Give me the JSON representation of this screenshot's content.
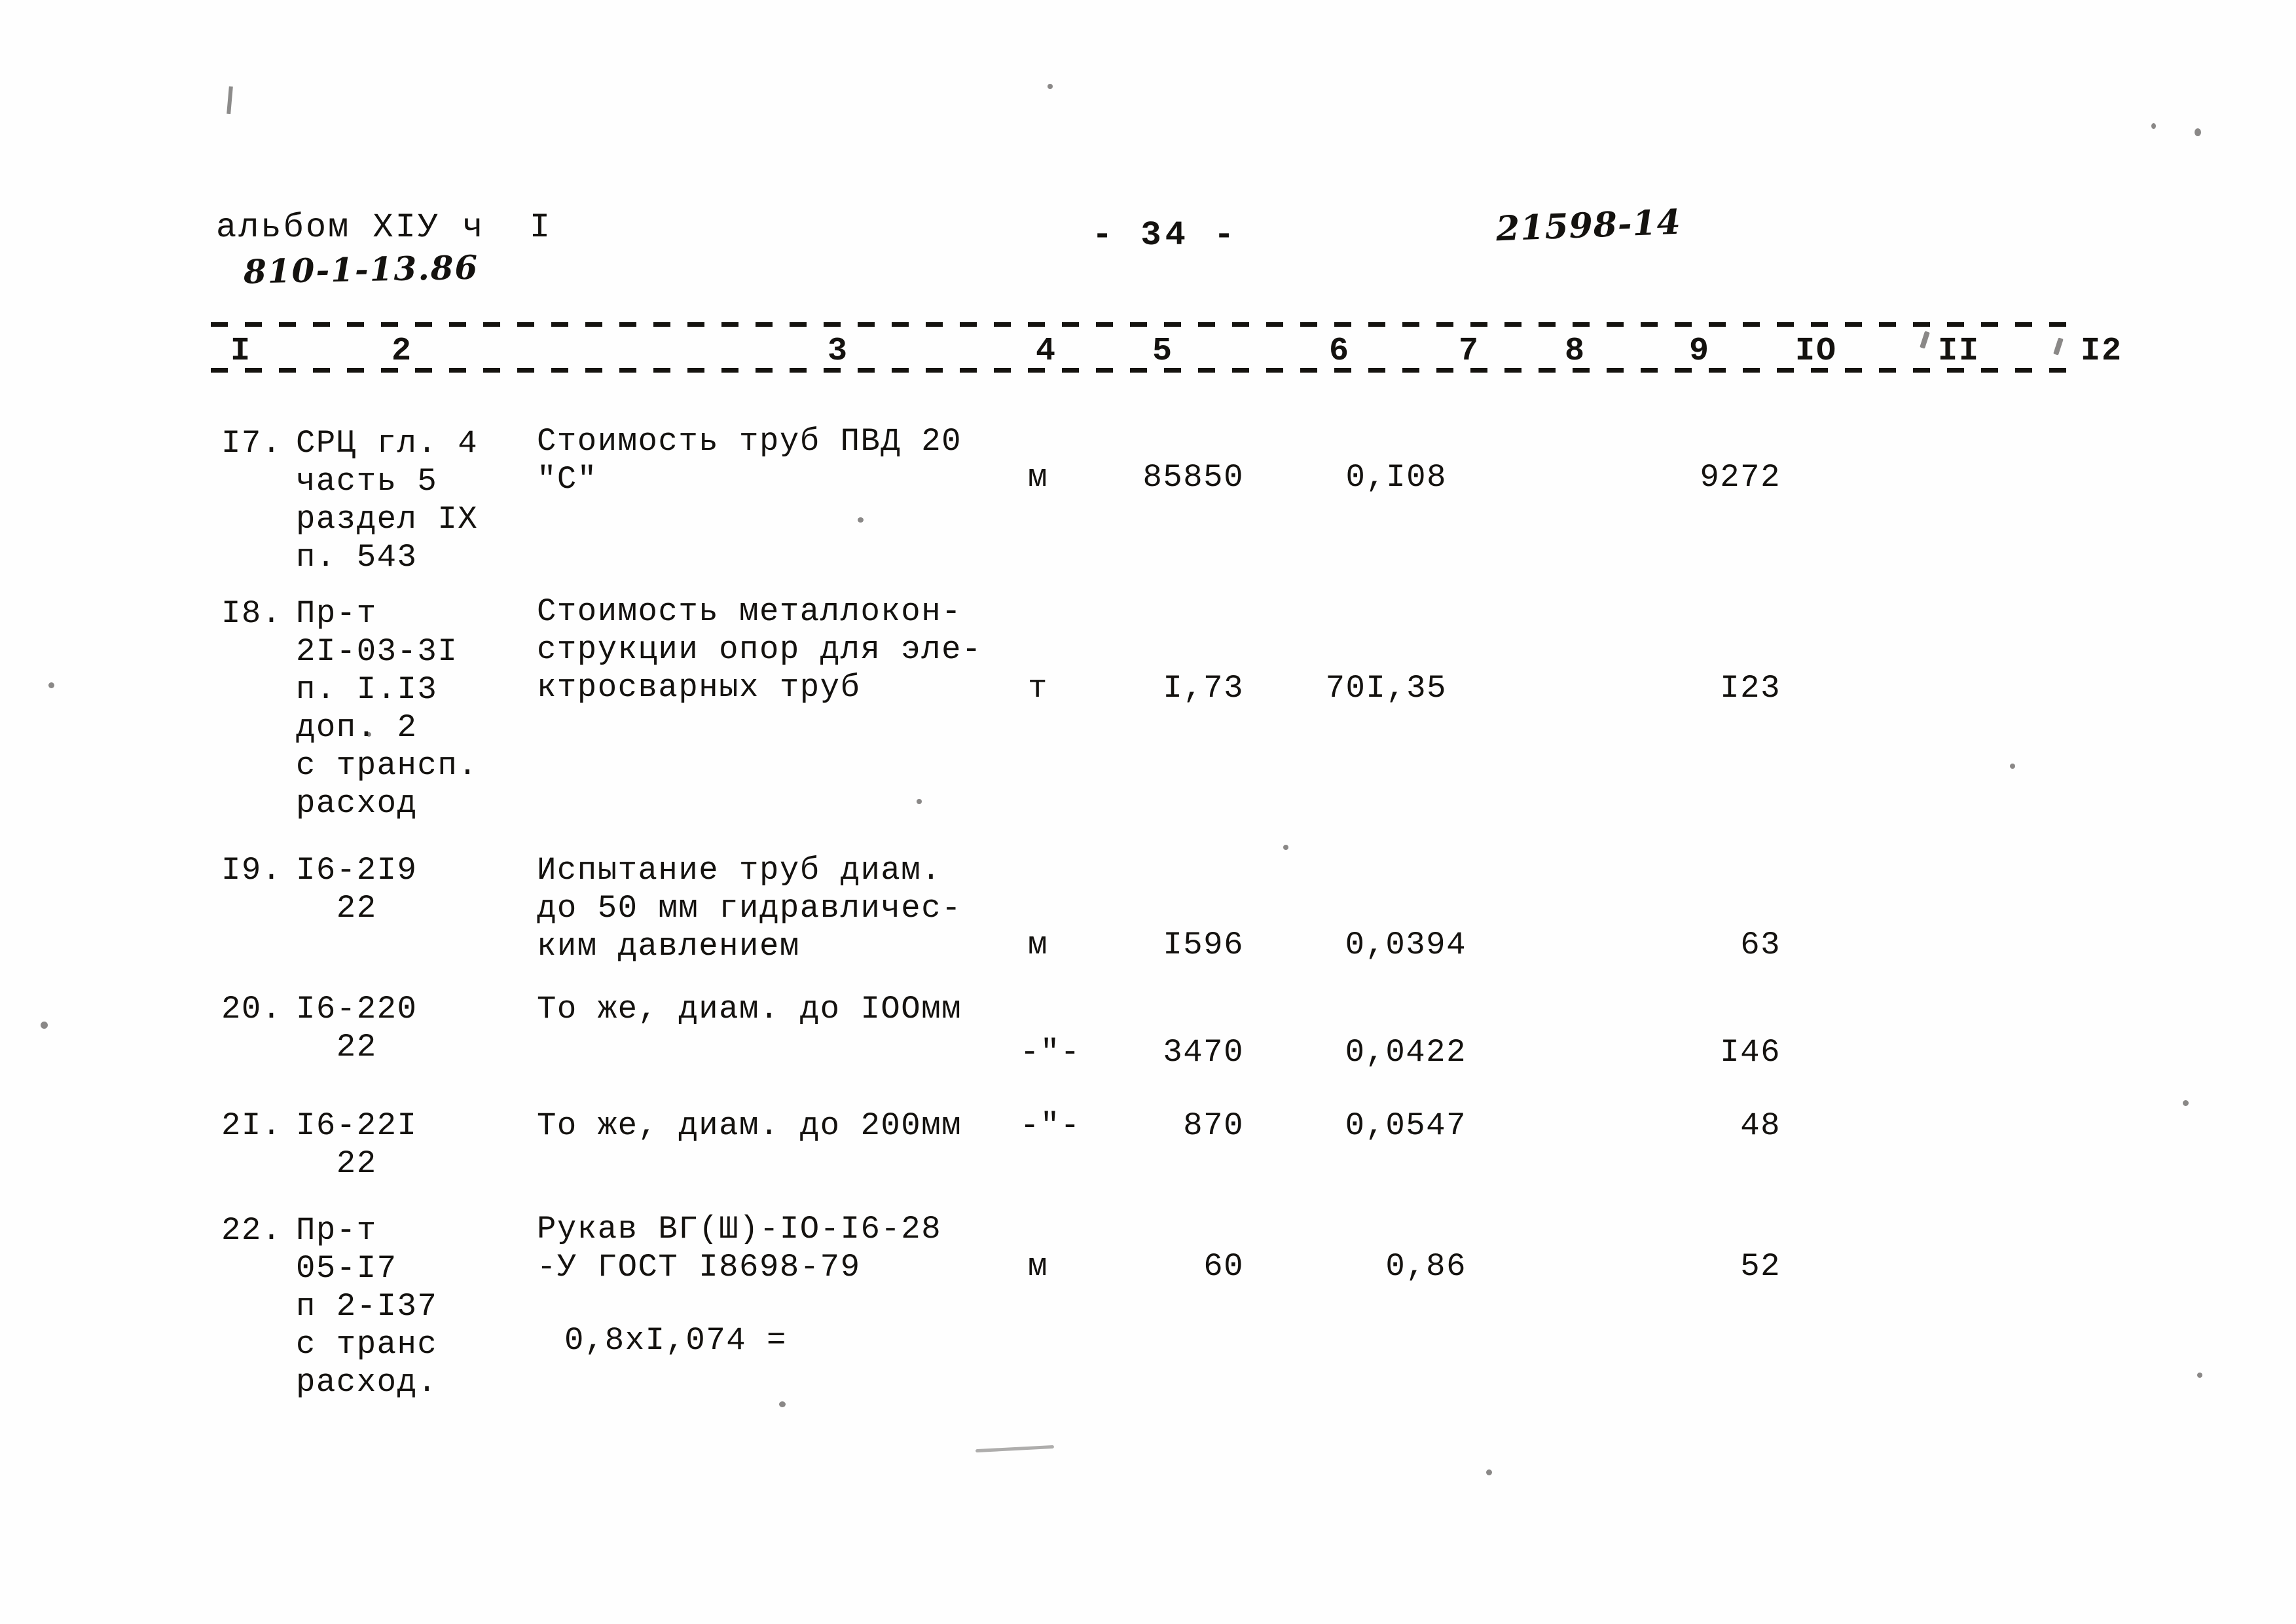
{
  "document": {
    "header": {
      "album_line": "альбом XIУ ч  I",
      "album_code": "810-1-13.86",
      "page_number": "- 34 -",
      "doc_code": "21598-14"
    },
    "column_numbers": [
      "I",
      "2",
      "3",
      "4",
      "5",
      "6",
      "7",
      "8",
      "9",
      "IO",
      "II",
      "I2"
    ],
    "rows": [
      {
        "no": "I7.",
        "code": "СРЦ гл. 4\nчасть 5\nраздел IX\nп. 543",
        "description": "Стоимость труб ПВД 20\n\"С\"",
        "unit": "м",
        "quantity": "85850",
        "unit_price": "0,I08",
        "col7": "",
        "col8": "",
        "total": "9272",
        "col10": "",
        "col11": "",
        "col12": ""
      },
      {
        "no": "I8.",
        "code": "Пр-т\n2I-03-3I\nп. I.I3\nдоп. 2\nс трансп.\nрасход",
        "description": "Стоимость металлокон-\nструкции опор для эле-\nктросварных труб",
        "unit": "т",
        "quantity": "I,73",
        "unit_price": "70I,35",
        "col7": "",
        "col8": "",
        "total": "I23",
        "col10": "",
        "col11": "",
        "col12": ""
      },
      {
        "no": "I9.",
        "code": "I6-2I9\n  22",
        "description": "Испытание труб диам.\nдо 50 мм гидравличес-\nким давлением",
        "unit": "м",
        "quantity": "I596",
        "unit_price": "0,0394",
        "col7": "",
        "col8": "",
        "total": "63",
        "col10": "",
        "col11": "",
        "col12": ""
      },
      {
        "no": "20.",
        "code": "I6-220\n  22",
        "description": "То же, диам. до IOOмм",
        "unit": "-\"-",
        "quantity": "3470",
        "unit_price": "0,0422",
        "col7": "",
        "col8": "",
        "total": "I46",
        "col10": "",
        "col11": "",
        "col12": ""
      },
      {
        "no": "2I.",
        "code": "I6-22I\n  22",
        "description": "То же, диам. до 200мм",
        "unit": "-\"-",
        "quantity": "870",
        "unit_price": "0,0547",
        "col7": "",
        "col8": "",
        "total": "48",
        "col10": "",
        "col11": "",
        "col12": ""
      },
      {
        "no": "22.",
        "code": "Пр-т\n05-I7\nп 2-I37\nс транс\nрасход.",
        "description": "Рукав ВГ(Ш)-IO-I6-28\n-У ГОСТ I8698-79",
        "description_note": "0,8xI,074 =",
        "unit": "м",
        "quantity": "60",
        "unit_price": "0,86",
        "col7": "",
        "col8": "",
        "total": "52",
        "col10": "",
        "col11": "",
        "col12": ""
      }
    ]
  }
}
